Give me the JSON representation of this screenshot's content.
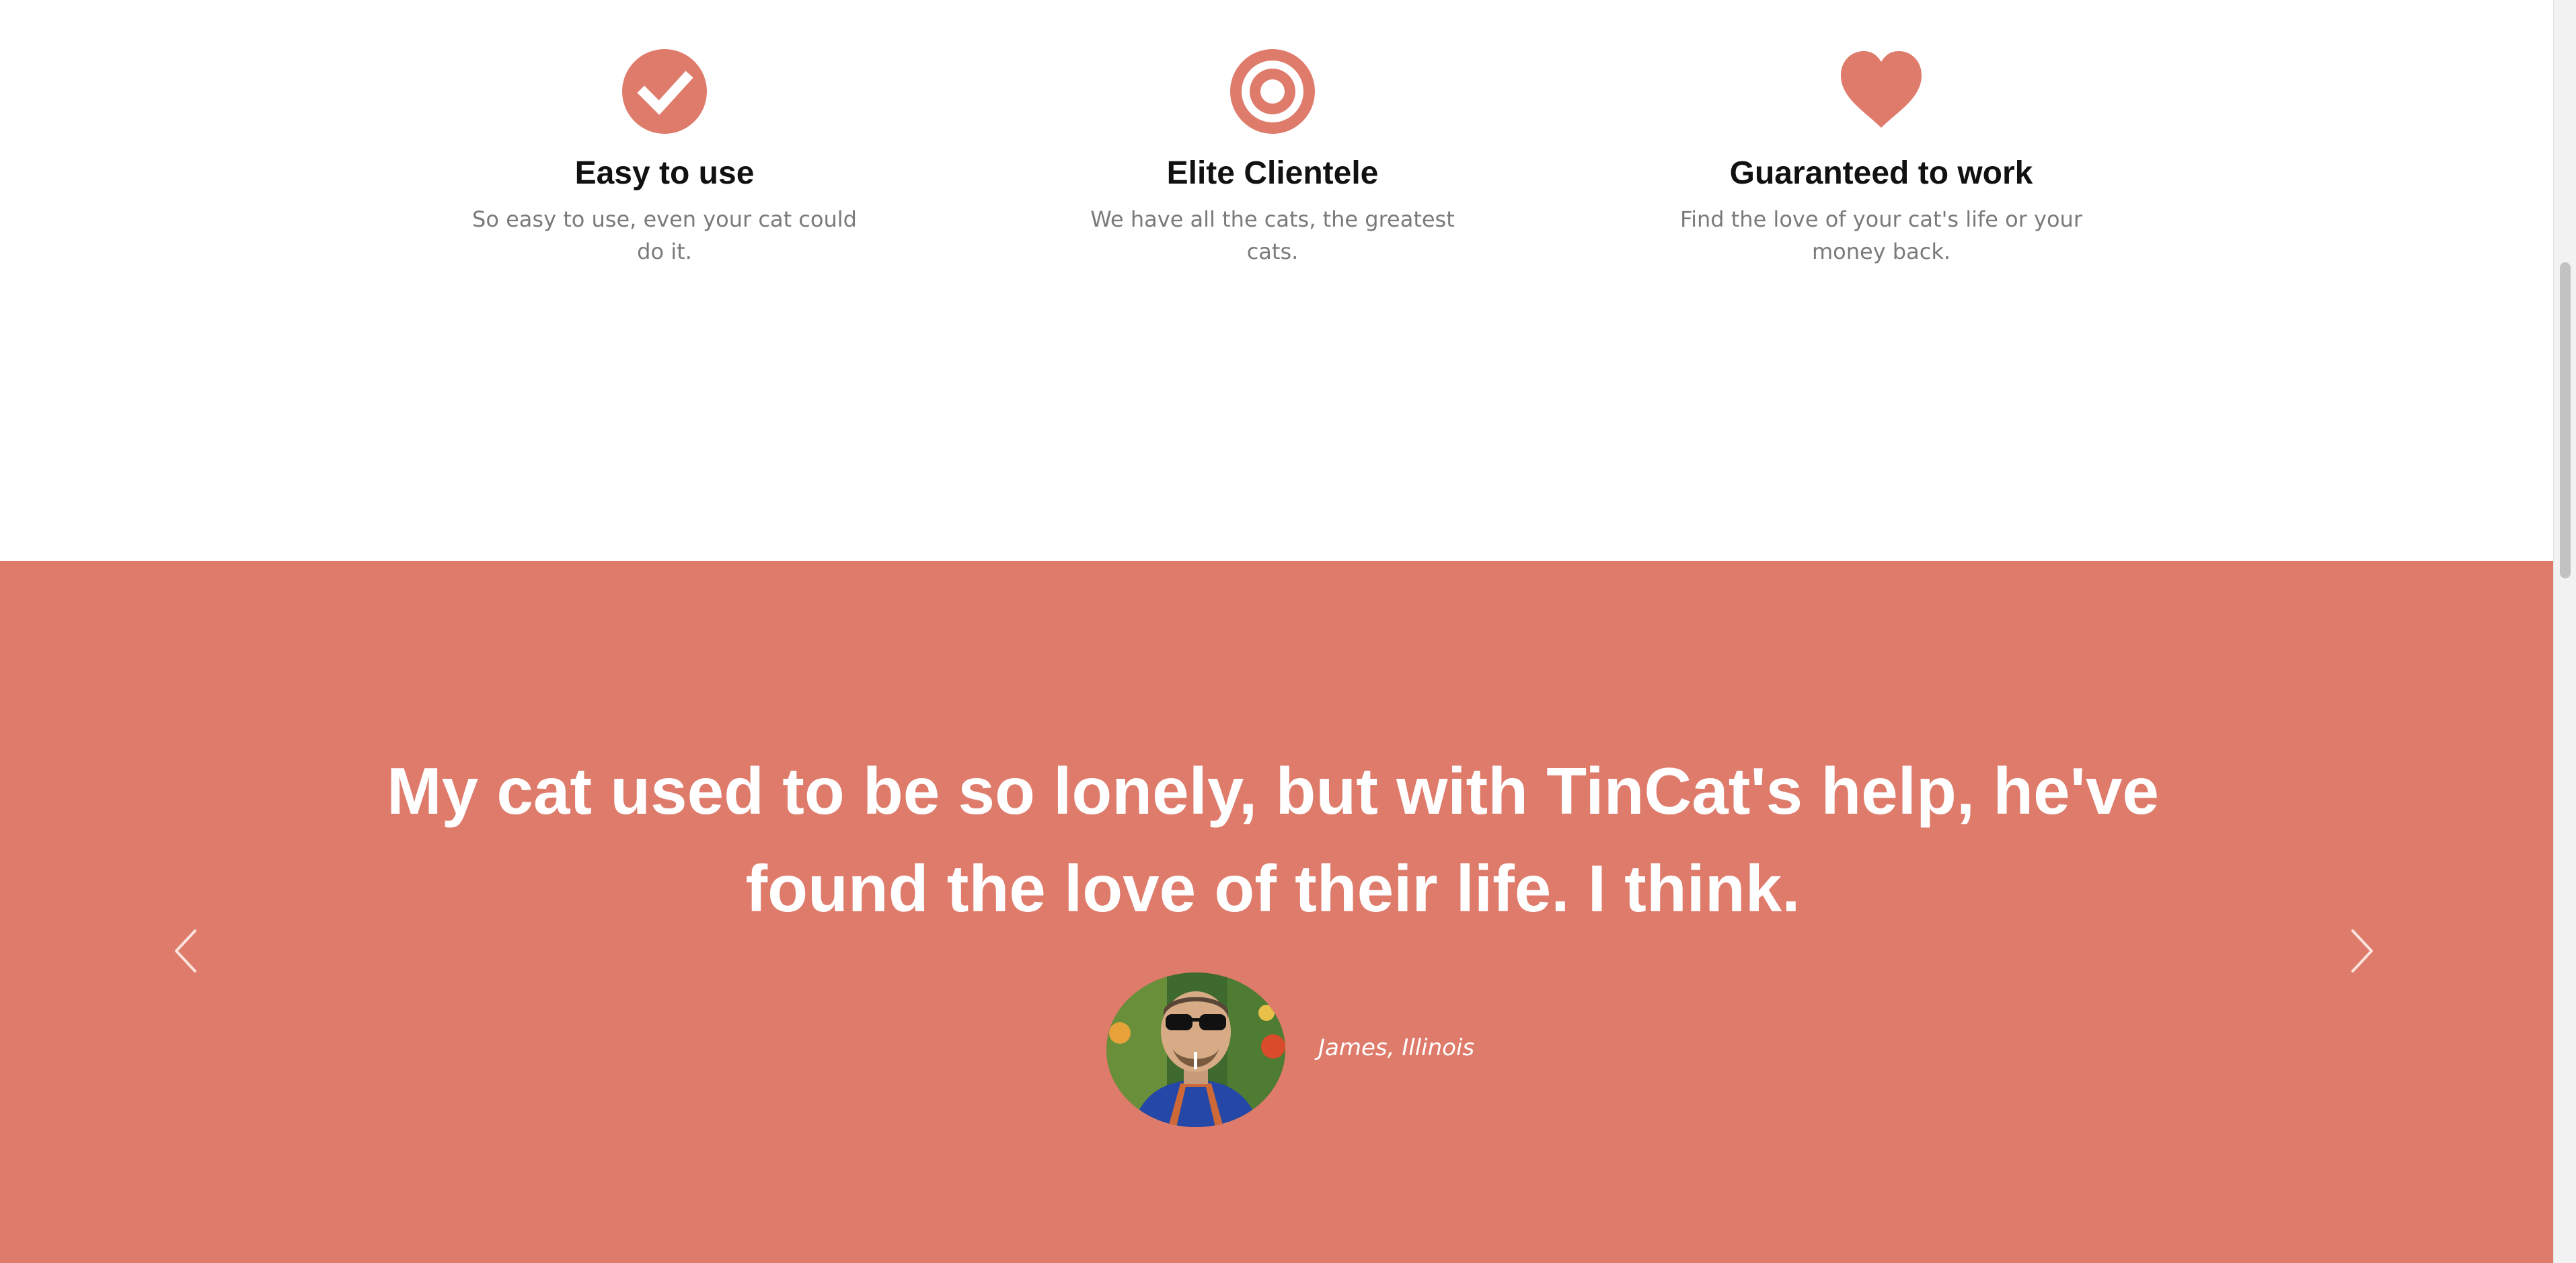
{
  "features": {
    "items": [
      {
        "icon": "check-circle-icon",
        "title": "Easy to use",
        "description": "So easy to use, even your cat could do it."
      },
      {
        "icon": "bullseye-icon",
        "title": "Elite Clientele",
        "description": "We have all the cats, the greatest cats."
      },
      {
        "icon": "heart-icon",
        "title": "Guaranteed to work",
        "description": "Find the love of your cat's life or your money back."
      }
    ],
    "icon_color": "#df7b6b"
  },
  "testimonials": {
    "background_color": "#df7b6b",
    "quote": "My cat used to be so lonely, but with TinCat's help, he've found the love of their life. I think.",
    "author": "James, Illinois",
    "prev_icon": "chevron-left-icon",
    "next_icon": "chevron-right-icon"
  }
}
